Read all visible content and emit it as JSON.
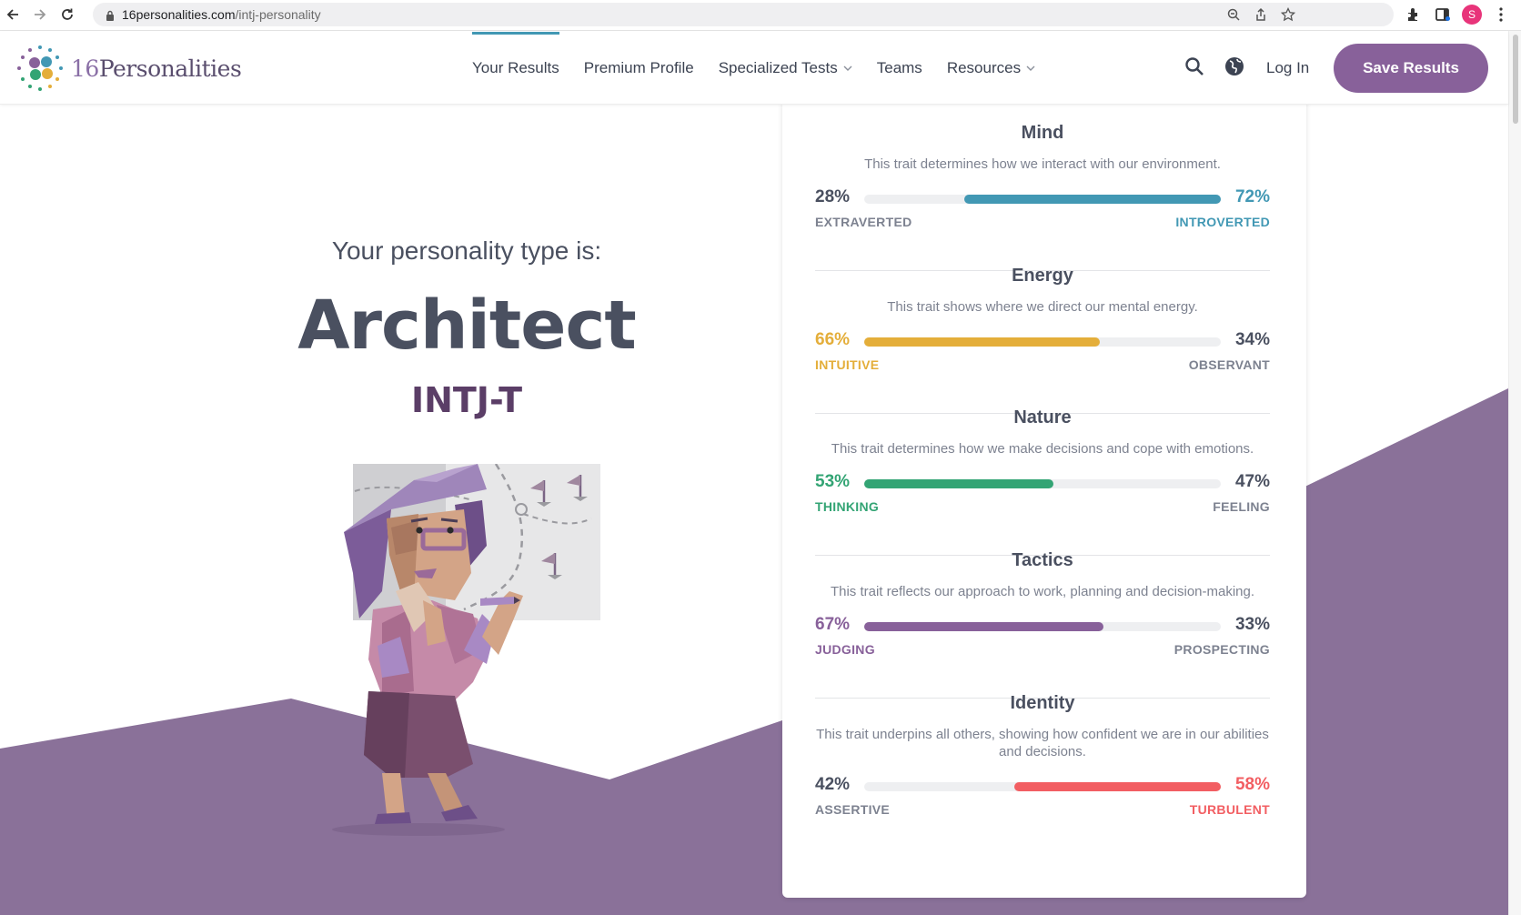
{
  "browser": {
    "url_domain": "16personalities.com",
    "url_path": "/intj-personality",
    "profile_initial": "S"
  },
  "header": {
    "logo_number": "16",
    "logo_word": "Personalities",
    "nav": [
      {
        "label": "Your Results",
        "active": true,
        "dropdown": false
      },
      {
        "label": "Premium Profile",
        "active": false,
        "dropdown": false
      },
      {
        "label": "Specialized Tests",
        "active": false,
        "dropdown": true
      },
      {
        "label": "Teams",
        "active": false,
        "dropdown": false
      },
      {
        "label": "Resources",
        "active": false,
        "dropdown": true
      }
    ],
    "login_label": "Log In",
    "save_label": "Save Results"
  },
  "result": {
    "intro": "Your personality type is:",
    "type_name": "Architect",
    "type_code": "INTJ-T"
  },
  "traits": [
    {
      "title": "Mind",
      "description": "This trait determines how we interact with our environment.",
      "left_pct": "28%",
      "right_pct": "72%",
      "left_label": "EXTRAVERTED",
      "right_label": "INTROVERTED",
      "value": 72,
      "dominant": "right",
      "color": "#4298b4"
    },
    {
      "title": "Energy",
      "description": "This trait shows where we direct our mental energy.",
      "left_pct": "66%",
      "right_pct": "34%",
      "left_label": "INTUITIVE",
      "right_label": "OBSERVANT",
      "value": 66,
      "dominant": "left",
      "color": "#e4ae3a"
    },
    {
      "title": "Nature",
      "description": "This trait determines how we make decisions and cope with emotions.",
      "left_pct": "53%",
      "right_pct": "47%",
      "left_label": "THINKING",
      "right_label": "FEELING",
      "value": 53,
      "dominant": "left",
      "color": "#33a474"
    },
    {
      "title": "Tactics",
      "description": "This trait reflects our approach to work, planning and decision-making.",
      "left_pct": "67%",
      "right_pct": "33%",
      "left_label": "JUDGING",
      "right_label": "PROSPECTING",
      "value": 67,
      "dominant": "left",
      "color": "#88619a"
    },
    {
      "title": "Identity",
      "description": "This trait underpins all others, showing how confident we are in our abilities and decisions.",
      "left_pct": "42%",
      "right_pct": "58%",
      "left_label": "ASSERTIVE",
      "right_label": "TURBULENT",
      "value": 58,
      "dominant": "right",
      "color": "#f25e62"
    }
  ],
  "colors": {
    "neutral": "#4a5060",
    "label_neutral": "#7d8290",
    "brand_purple": "#88619a",
    "bg_purple": "#8a7199"
  }
}
